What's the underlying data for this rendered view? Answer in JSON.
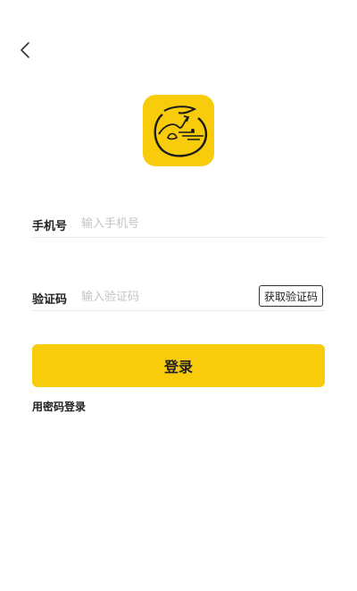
{
  "nav": {
    "back_icon": "chevron-left-icon"
  },
  "logo": {
    "icon": "app-logo-icon",
    "accent_color": "#f8cc0a"
  },
  "form": {
    "phone": {
      "label": "手机号",
      "placeholder": "输入手机号",
      "value": ""
    },
    "code": {
      "label": "验证码",
      "placeholder": "输入验证码",
      "value": "",
      "get_code_label": "获取验证码"
    }
  },
  "login_button": {
    "label": "登录",
    "color": "#f8cc0a"
  },
  "password_login_link": "用密码登录"
}
